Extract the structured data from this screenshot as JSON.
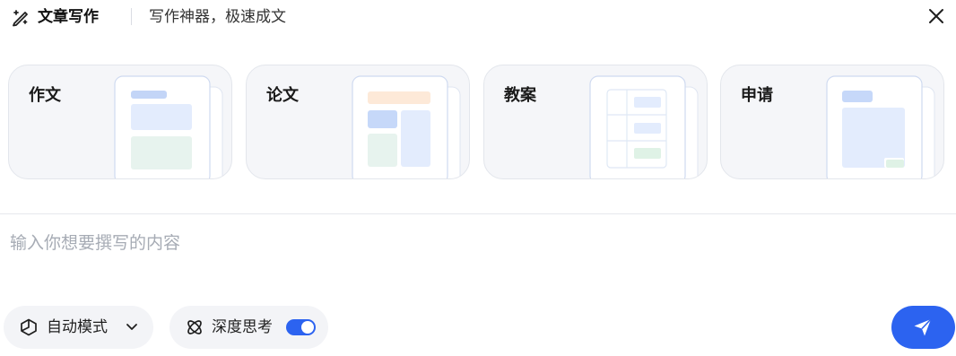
{
  "header": {
    "title": "文章写作",
    "subtitle": "写作神器，极速成文",
    "title_icon": "pen-sparkle-icon",
    "close_icon": "close-icon"
  },
  "cards": [
    {
      "label": "作文",
      "preview": "essay-template-preview"
    },
    {
      "label": "论文",
      "preview": "paper-template-preview"
    },
    {
      "label": "教案",
      "preview": "lesson-plan-template-preview"
    },
    {
      "label": "申请",
      "preview": "application-template-preview"
    }
  ],
  "input": {
    "value": "",
    "placeholder": "输入你想要撰写的内容"
  },
  "toolbar": {
    "mode_label": "自动模式",
    "mode_icon": "cube-icon",
    "mode_dropdown_icon": "chevron-down-icon",
    "deep_think_label": "深度思考",
    "deep_think_icon": "atom-icon",
    "deep_think_on": true,
    "send_icon": "send-icon"
  },
  "colors": {
    "accent": "#2c63f0",
    "card_bg": "#f5f6f9",
    "placeholder": "#a6abb4"
  }
}
